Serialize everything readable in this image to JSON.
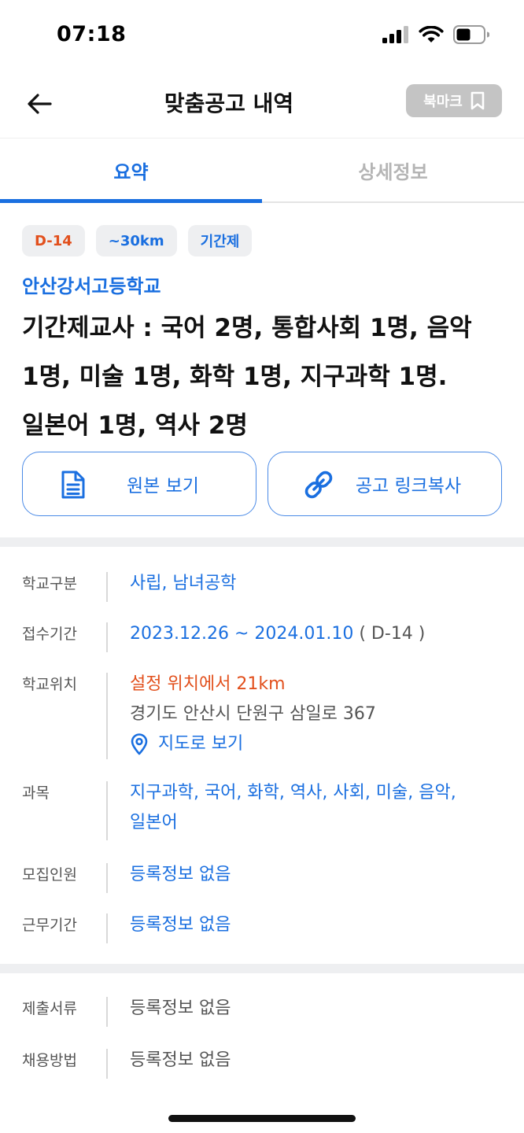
{
  "status_bar": {
    "time": "07:18"
  },
  "header": {
    "title": "맞춤공고 내역",
    "bookmark_label": "북마크"
  },
  "tabs": [
    {
      "label": "요약",
      "active": true
    },
    {
      "label": "상세정보",
      "active": false
    }
  ],
  "summary": {
    "chips": [
      "D-14",
      "~30km",
      "기간제"
    ],
    "school_name": "안산강서고등학교",
    "title": "기간제교사 : 국어 2명, 통합사회 1명, 음악 1명, 미술 1명, 화학 1명, 지구과학 1명. 일본어 1명, 역사 2명",
    "view_original_label": "원본 보기",
    "copy_link_label": "공고 링크복사"
  },
  "info": {
    "school_type": {
      "label": "학교구분",
      "value": "사립, 남녀공학"
    },
    "application_period": {
      "label": "접수기간",
      "dates": "2023.12.26 ~ 2024.01.10",
      "dday": "( D-14 )"
    },
    "location": {
      "label": "학교위치",
      "distance": "설정 위치에서 21km",
      "address": "경기도 안산시 단원구 삼일로 367",
      "map_link": "지도로 보기"
    },
    "subjects": {
      "label": "과목",
      "value": "지구과학, 국어, 화학, 역사, 사회, 미술, 음악, 일본어"
    },
    "recruit_count": {
      "label": "모집인원",
      "value": "등록정보 없음"
    },
    "work_period": {
      "label": "근무기간",
      "value": "등록정보 없음"
    },
    "documents": {
      "label": "제출서류",
      "value": "등록정보 없음"
    },
    "hiring_method": {
      "label": "채용방법",
      "value": "등록정보 없음"
    }
  },
  "colors": {
    "accent": "#1a6fe0",
    "danger": "#e2501d",
    "muted": "#555555",
    "bookmark_bg": "#c4c4c4"
  }
}
